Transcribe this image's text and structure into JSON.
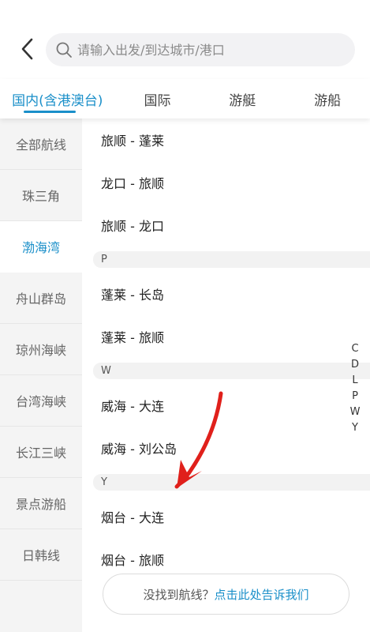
{
  "search": {
    "placeholder": "请输入出发/到达城市/港口",
    "value": ""
  },
  "tabs": [
    {
      "label": "国内(含港澳台)",
      "active": true
    },
    {
      "label": "国际",
      "active": false
    },
    {
      "label": "游艇",
      "active": false
    },
    {
      "label": "游船",
      "active": false
    }
  ],
  "sidebar": {
    "items": [
      {
        "label": "全部航线"
      },
      {
        "label": "珠三角"
      },
      {
        "label": "渤海湾"
      },
      {
        "label": "舟山群岛"
      },
      {
        "label": "琼州海峡"
      },
      {
        "label": "台湾海峡"
      },
      {
        "label": "长江三峡"
      },
      {
        "label": "景点游船"
      },
      {
        "label": "日韩线"
      }
    ],
    "active_index": 2
  },
  "routes": {
    "r0": "旅顺 - 蓬莱",
    "r1": "龙口 - 旅顺",
    "r2": "旅顺 - 龙口",
    "sec_p": "P",
    "r3": "蓬莱 - 长岛",
    "r4": "蓬莱 - 旅顺",
    "sec_w": "W",
    "r5": "威海 - 大连",
    "r6": "威海 - 刘公岛",
    "sec_y": "Y",
    "r7": "烟台 - 大连",
    "r8": "烟台 - 旅顺"
  },
  "index": [
    "C",
    "D",
    "L",
    "P",
    "W",
    "Y"
  ],
  "feedback": {
    "prefix": "没找到航线？",
    "link": "点击此处告诉我们"
  },
  "colors": {
    "accent": "#1a8fc9",
    "annotation_arrow": "#e0201b"
  }
}
